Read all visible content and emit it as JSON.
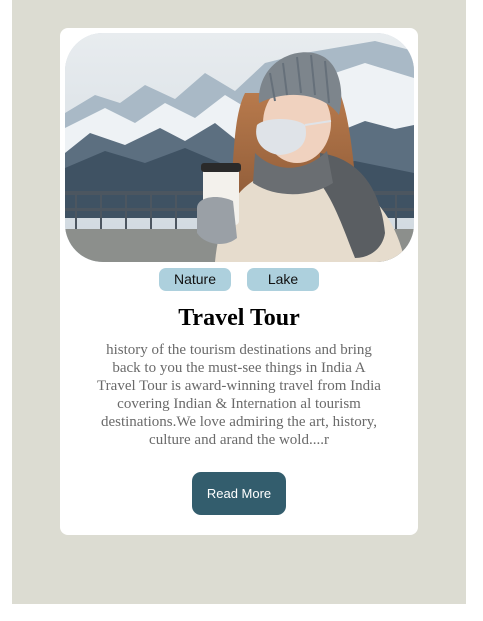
{
  "card": {
    "image_alt": "woman-with-mask-holding-coffee-mountains",
    "tags": [
      "Nature",
      "Lake"
    ],
    "title": "Travel Tour",
    "description": "history of the tourism destinations and bring back to you the must-see things in India A Travel Tour is award-winning travel from India covering Indian & Internation al tourism destinations.We love admiring the art, history, culture and arand the wold....r",
    "button_label": "Read More"
  },
  "colors": {
    "page_background": "#dcdcd2",
    "card_background": "#ffffff",
    "tag_background": "#add0dd",
    "button_background": "#335d6d",
    "button_text": "#ffffff",
    "description_text": "#6a6a6a"
  }
}
